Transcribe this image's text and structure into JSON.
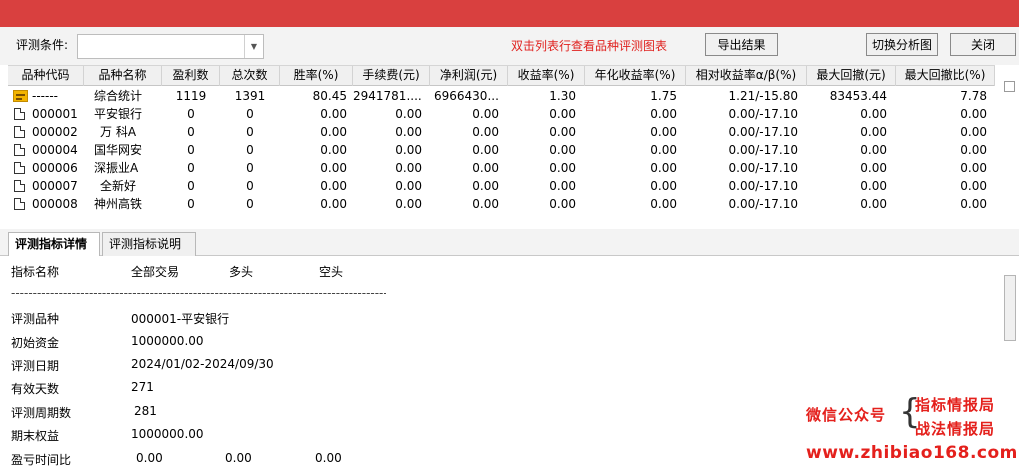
{
  "toolbar": {
    "condition_label": "评测条件:",
    "condition_value": "",
    "hint": "双击列表行查看品种评测图表",
    "export_label": "导出结果",
    "switch_label": "切换分析图",
    "close_label": "关闭"
  },
  "table": {
    "columns": [
      "品种代码",
      "品种名称",
      "盈利数",
      "总次数",
      "胜率(%)",
      "手续费(元)",
      "净利润(元)",
      "收益率(%)",
      "年化收益率(%)",
      "相对收益率α/β(%)",
      "最大回撤(元)",
      "最大回撤比(%)"
    ],
    "rows": [
      {
        "icon": "summary-icon",
        "code": "------",
        "name": "综合统计",
        "profit_count": "1119",
        "total": "1391",
        "win_rate": "80.45",
        "fee": "2941781....",
        "net_profit": "6966430...",
        "return": "1.30",
        "annual_return": "1.75",
        "relative": "1.21/-15.80",
        "max_dd": "83453.44",
        "max_dd_ratio": "7.78"
      },
      {
        "icon": "document-icon",
        "code": "000001",
        "name": "平安银行",
        "profit_count": "0",
        "total": "0",
        "win_rate": "0.00",
        "fee": "0.00",
        "net_profit": "0.00",
        "return": "0.00",
        "annual_return": "0.00",
        "relative": "0.00/-17.10",
        "max_dd": "0.00",
        "max_dd_ratio": "0.00"
      },
      {
        "icon": "document-icon",
        "code": "000002",
        "name": "万 科A",
        "profit_count": "0",
        "total": "0",
        "win_rate": "0.00",
        "fee": "0.00",
        "net_profit": "0.00",
        "return": "0.00",
        "annual_return": "0.00",
        "relative": "0.00/-17.10",
        "max_dd": "0.00",
        "max_dd_ratio": "0.00"
      },
      {
        "icon": "document-icon",
        "code": "000004",
        "name": "国华网安",
        "profit_count": "0",
        "total": "0",
        "win_rate": "0.00",
        "fee": "0.00",
        "net_profit": "0.00",
        "return": "0.00",
        "annual_return": "0.00",
        "relative": "0.00/-17.10",
        "max_dd": "0.00",
        "max_dd_ratio": "0.00"
      },
      {
        "icon": "document-icon",
        "code": "000006",
        "name": "深振业A",
        "profit_count": "0",
        "total": "0",
        "win_rate": "0.00",
        "fee": "0.00",
        "net_profit": "0.00",
        "return": "0.00",
        "annual_return": "0.00",
        "relative": "0.00/-17.10",
        "max_dd": "0.00",
        "max_dd_ratio": "0.00"
      },
      {
        "icon": "document-icon",
        "code": "000007",
        "name": "全新好",
        "profit_count": "0",
        "total": "0",
        "win_rate": "0.00",
        "fee": "0.00",
        "net_profit": "0.00",
        "return": "0.00",
        "annual_return": "0.00",
        "relative": "0.00/-17.10",
        "max_dd": "0.00",
        "max_dd_ratio": "0.00"
      },
      {
        "icon": "document-icon",
        "code": "000008",
        "name": "神州高铁",
        "profit_count": "0",
        "total": "0",
        "win_rate": "0.00",
        "fee": "0.00",
        "net_profit": "0.00",
        "return": "0.00",
        "annual_return": "0.00",
        "relative": "0.00/-17.10",
        "max_dd": "0.00",
        "max_dd_ratio": "0.00"
      }
    ]
  },
  "tabs": [
    {
      "label": "评测指标详情",
      "active": true
    },
    {
      "label": "评测指标说明",
      "active": false
    }
  ],
  "detail": {
    "header": {
      "name": "指标名称",
      "all": "全部交易",
      "long": "多头",
      "short": "空头"
    },
    "divider": "----------------------------------------------------------------------------------------------------",
    "rows": [
      {
        "label": "评测品种",
        "value": "000001-平安银行"
      },
      {
        "label": "初始资金",
        "value": "1000000.00"
      },
      {
        "label": "评测日期",
        "value": "2024/01/02-2024/09/30"
      },
      {
        "label": "有效天数",
        "value": "271"
      },
      {
        "label": "评测周期数",
        "value": "281"
      },
      {
        "label": "期末权益",
        "value": "1000000.00"
      }
    ],
    "last_row": {
      "label": "盈亏时间比",
      "all": "0.00",
      "long": "0.00",
      "short": "0.00"
    }
  },
  "watermark": {
    "wechat": "微信公众号",
    "line1": "指标情报局",
    "line2": "战法情报局",
    "url": "www.zhibiao168.com"
  },
  "colors": {
    "titlebar": "#d9403f",
    "hint": "#e0221f",
    "watermark": "#e4201c"
  }
}
